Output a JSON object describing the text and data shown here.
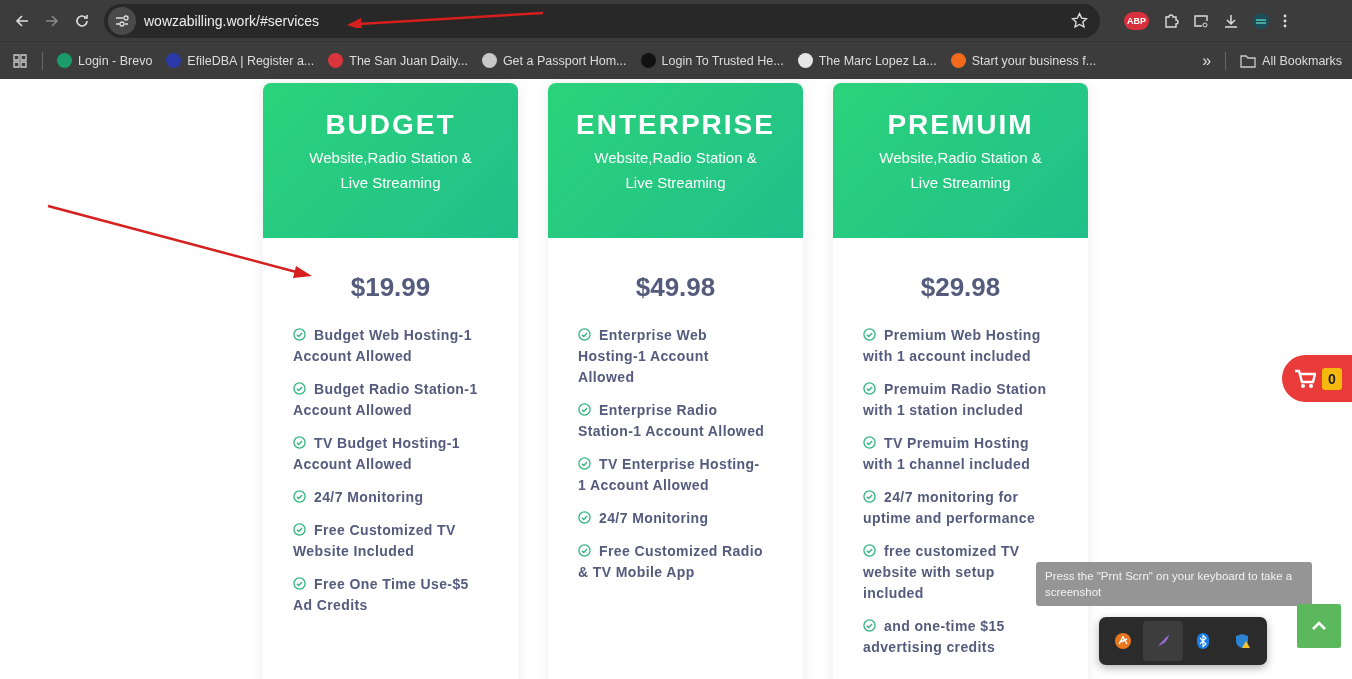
{
  "browser": {
    "url": "wowzabilling.work/#services",
    "extension_badge": "ABP",
    "bookmarks": [
      {
        "label": "Login - Brevo",
        "color": "#1a9c6b"
      },
      {
        "label": "EfileDBA | Register a...",
        "color": "#2b3aa8"
      },
      {
        "label": "The San Juan Daily...",
        "color": "#d9363e"
      },
      {
        "label": "Get a Passport Hom...",
        "color": "#c8c8c8"
      },
      {
        "label": "Login To Trusted He...",
        "color": "#111111"
      },
      {
        "label": "The Marc Lopez La...",
        "color": "#e6e6e6"
      },
      {
        "label": "Start your business f...",
        "color": "#f26b1d"
      }
    ],
    "more_bookmarks": "»",
    "all_bookmarks": "All Bookmarks"
  },
  "plans": [
    {
      "name": "BUDGET",
      "subtitle": "Website,Radio Station & Live Streaming",
      "price": "$19.99",
      "features": [
        "Budget Web Hosting-1 Account Allowed",
        "Budget Radio Station-1 Account Allowed",
        "TV Budget Hosting-1 Account Allowed",
        "24/7 Monitoring",
        "Free Customized TV Website Included",
        "Free One Time Use-$5 Ad Credits"
      ]
    },
    {
      "name": "ENTERPRISE",
      "subtitle": "Website,Radio Station & Live Streaming",
      "price": "$49.98",
      "features": [
        "Enterprise Web Hosting-1 Account Allowed",
        "Enterprise Radio Station-1 Account Allowed",
        "TV Enterprise Hosting-1 Account Allowed",
        "24/7 Monitoring",
        "Free Customized Radio & TV Mobile App"
      ]
    },
    {
      "name": "PREMUIM",
      "subtitle": "Website,Radio Station & Live Streaming",
      "price": "$29.98",
      "features": [
        "Premium Web Hosting with 1 account included",
        "Premuim Radio Station with 1 station included",
        "TV Premuim Hosting with 1 channel included",
        "24/7 monitoring for uptime and performance",
        "free customized TV website with setup included",
        "and one-time $15 advertising credits"
      ]
    }
  ],
  "cart": {
    "count": "0"
  },
  "tooltip": "Press the \"Prnt Scrn\" on your keyboard to take a screenshot",
  "tray": [
    {
      "selected": false
    },
    {
      "selected": true
    },
    {
      "selected": false
    },
    {
      "selected": false
    }
  ]
}
